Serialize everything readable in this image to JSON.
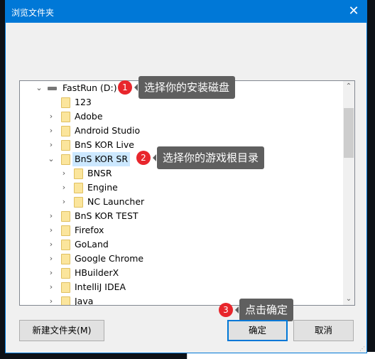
{
  "title": "浏览文件夹",
  "tree": {
    "root": "FastRun (D:)",
    "items": [
      {
        "label": "123",
        "level": 1,
        "chevron": "none"
      },
      {
        "label": "Adobe",
        "level": 1,
        "chevron": "right"
      },
      {
        "label": "Android Studio",
        "level": 1,
        "chevron": "right"
      },
      {
        "label": "BnS KOR Live",
        "level": 1,
        "chevron": "right"
      },
      {
        "label": "BnS KOR SR",
        "level": 1,
        "chevron": "down",
        "selected": true
      },
      {
        "label": "BNSR",
        "level": 2,
        "chevron": "right"
      },
      {
        "label": "Engine",
        "level": 2,
        "chevron": "right"
      },
      {
        "label": "NC Launcher",
        "level": 2,
        "chevron": "right"
      },
      {
        "label": "BnS KOR TEST",
        "level": 1,
        "chevron": "right"
      },
      {
        "label": "Firefox",
        "level": 1,
        "chevron": "right"
      },
      {
        "label": "GoLand",
        "level": 1,
        "chevron": "right"
      },
      {
        "label": "Google Chrome",
        "level": 1,
        "chevron": "right"
      },
      {
        "label": "HBuilderX",
        "level": 1,
        "chevron": "right"
      },
      {
        "label": "IntelliJ IDEA",
        "level": 1,
        "chevron": "right"
      },
      {
        "label": "Java",
        "level": 1,
        "chevron": "right"
      }
    ]
  },
  "annotations": [
    {
      "num": "1",
      "text": "选择你的安装磁盘"
    },
    {
      "num": "2",
      "text": "选择你的游戏根目录"
    },
    {
      "num": "3",
      "text": "点击确定"
    }
  ],
  "buttons": {
    "new_folder": "新建文件夹(M)",
    "ok": "确定",
    "cancel": "取消"
  },
  "colors": {
    "titlebar": "#0078d7",
    "badge": "#e8262c",
    "selection": "#cce8ff"
  }
}
